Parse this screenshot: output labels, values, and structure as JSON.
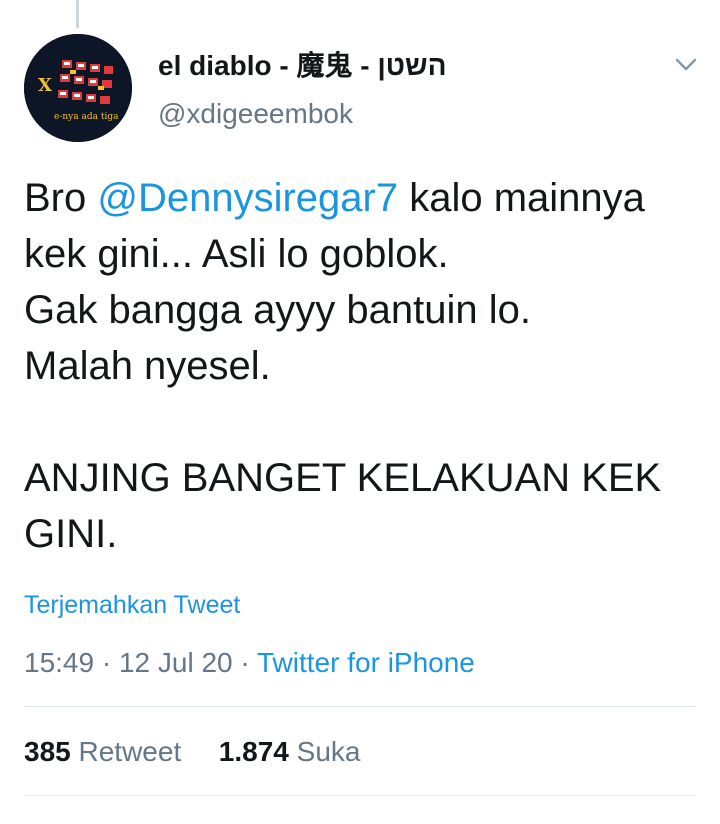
{
  "tweet": {
    "display_name": "el diablo - 魔鬼 - השטן",
    "handle": "@xdigeeembok",
    "avatar": {
      "letter": "X",
      "caption": "e-nya ada tiga"
    },
    "text_prefix": "Bro ",
    "mention": "@Dennysiregar7",
    "text_rest": " kalo mainnya\nkek gini... Asli lo goblok.\nGak bangga ayyy bantuin lo.\nMalah nyesel.\n\nANJING BANGET KELAKUAN KEK\nGINI.",
    "translate_label": "Terjemahkan Tweet",
    "time": "15:49",
    "separator": " · ",
    "date": "12 Jul 20",
    "source": "Twitter for iPhone",
    "retweet_count": "385",
    "retweet_label": "Retweet",
    "like_count": "1.874",
    "like_label": "Suka"
  },
  "icons": {
    "more": "chevron-down-icon"
  },
  "colors": {
    "link": "#1b95e0",
    "secondary_text": "#657786",
    "divider": "#e1e8ed",
    "avatar_background": "#0c1626"
  }
}
